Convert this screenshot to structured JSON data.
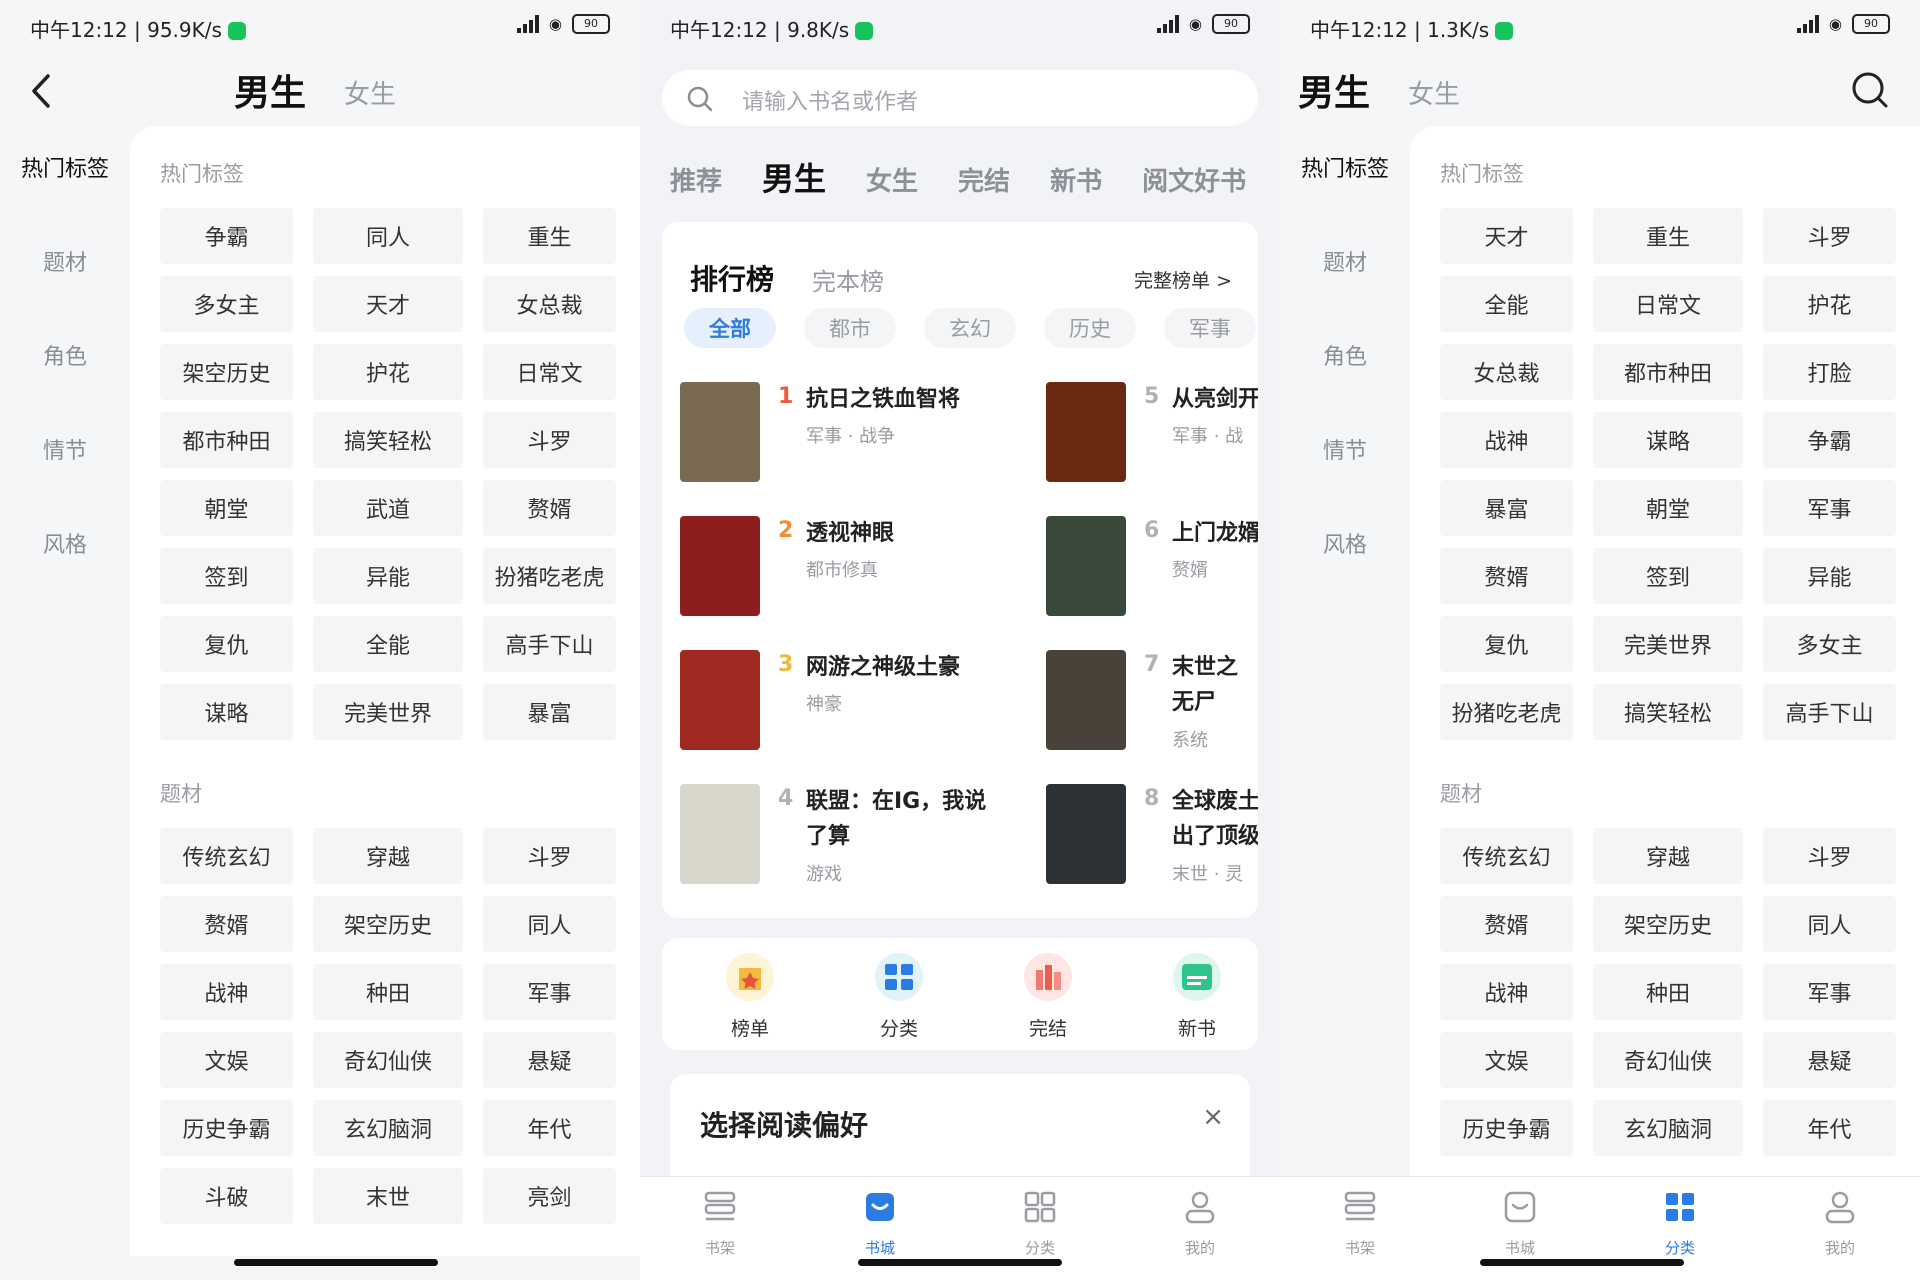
{
  "colors": {
    "accent": "#2b7be5",
    "rank1": "#f0563b",
    "rank2": "#f28d32",
    "rank3": "#f3b83a",
    "wechat": "#17c45b"
  },
  "panel1": {
    "status": {
      "time": "中午12:12 | 95.9K/s",
      "battery": "90"
    },
    "gender": {
      "active": "男生",
      "inactive": "女生"
    },
    "sidebar": [
      {
        "label": "热门标签"
      },
      {
        "label": "题材"
      },
      {
        "label": "角色"
      },
      {
        "label": "情节"
      },
      {
        "label": "风格"
      }
    ],
    "hot_title": "热门标签",
    "hot_tags": [
      "争霸",
      "同人",
      "重生",
      "多女主",
      "天才",
      "女总裁",
      "架空历史",
      "护花",
      "日常文",
      "都市种田",
      "搞笑轻松",
      "斗罗",
      "朝堂",
      "武道",
      "赘婿",
      "签到",
      "异能",
      "扮猪吃老虎",
      "复仇",
      "全能",
      "高手下山",
      "谋略",
      "完美世界",
      "暴富"
    ],
    "topic_title": "题材",
    "topic_tags": [
      "传统玄幻",
      "穿越",
      "斗罗",
      "赘婿",
      "架空历史",
      "同人",
      "战神",
      "种田",
      "军事",
      "文娱",
      "奇幻仙侠",
      "悬疑",
      "历史争霸",
      "玄幻脑洞",
      "年代",
      "斗破",
      "末世",
      "亮剑"
    ]
  },
  "panel2": {
    "status": {
      "time": "中午12:12 | 9.8K/s",
      "battery": "90"
    },
    "search": {
      "placeholder": "请输入书名或作者"
    },
    "tabs": [
      {
        "label": "推荐"
      },
      {
        "label": "男生"
      },
      {
        "label": "女生"
      },
      {
        "label": "完结"
      },
      {
        "label": "新书"
      },
      {
        "label": "阅文好书"
      }
    ],
    "ranking": {
      "title": "排行榜",
      "subtitle": "完本榜",
      "more": "完整榜单 >",
      "chips": [
        "全部",
        "都市",
        "玄幻",
        "历史",
        "军事"
      ],
      "books": [
        {
          "rank": "1",
          "name": "抗日之铁血智将",
          "meta": "军事 · 战争",
          "cover": "#7a6a52"
        },
        {
          "rank": "2",
          "name": "透视神眼",
          "meta": "都市修真",
          "cover": "#8e1e1e"
        },
        {
          "rank": "3",
          "name": "网游之神级土豪",
          "meta": "神豪",
          "cover": "#a02a22"
        },
        {
          "rank": "4",
          "name": "联盟：在IG，我说了算",
          "meta": "游戏",
          "cover": "#d9d6cc"
        },
        {
          "rank": "5",
          "name": "从亮剑开",
          "meta": "军事 · 战",
          "cover": "#6b2a10"
        },
        {
          "rank": "6",
          "name": "上门龙婿",
          "meta": "赘婿",
          "cover": "#3a4a3a"
        },
        {
          "rank": "7",
          "name": "末世之无尸",
          "meta": "系统",
          "cover": "#4a4238"
        },
        {
          "rank": "8",
          "name": "全球废土出了顶级",
          "meta": "末世 · 灵",
          "cover": "#2b3134"
        }
      ]
    },
    "quick": [
      {
        "label": "榜单"
      },
      {
        "label": "分类"
      },
      {
        "label": "完结"
      },
      {
        "label": "新书"
      }
    ],
    "pref": {
      "title": "选择阅读偏好",
      "close": "×"
    },
    "nav": [
      {
        "label": "书架"
      },
      {
        "label": "书城"
      },
      {
        "label": "分类"
      },
      {
        "label": "我的"
      }
    ]
  },
  "panel3": {
    "status": {
      "time": "中午12:12 | 1.3K/s",
      "battery": "90"
    },
    "gender": {
      "active": "男生",
      "inactive": "女生"
    },
    "sidebar": [
      {
        "label": "热门标签"
      },
      {
        "label": "题材"
      },
      {
        "label": "角色"
      },
      {
        "label": "情节"
      },
      {
        "label": "风格"
      }
    ],
    "hot_title": "热门标签",
    "hot_tags": [
      "天才",
      "重生",
      "斗罗",
      "全能",
      "日常文",
      "护花",
      "女总裁",
      "都市种田",
      "打脸",
      "战神",
      "谋略",
      "争霸",
      "暴富",
      "朝堂",
      "军事",
      "赘婿",
      "签到",
      "异能",
      "复仇",
      "完美世界",
      "多女主",
      "扮猪吃老虎",
      "搞笑轻松",
      "高手下山"
    ],
    "topic_title": "题材",
    "topic_tags": [
      "传统玄幻",
      "穿越",
      "斗罗",
      "赘婿",
      "架空历史",
      "同人",
      "战神",
      "种田",
      "军事",
      "文娱",
      "奇幻仙侠",
      "悬疑",
      "历史争霸",
      "玄幻脑洞",
      "年代"
    ],
    "nav": [
      {
        "label": "书架"
      },
      {
        "label": "书城"
      },
      {
        "label": "分类"
      },
      {
        "label": "我的"
      }
    ]
  }
}
